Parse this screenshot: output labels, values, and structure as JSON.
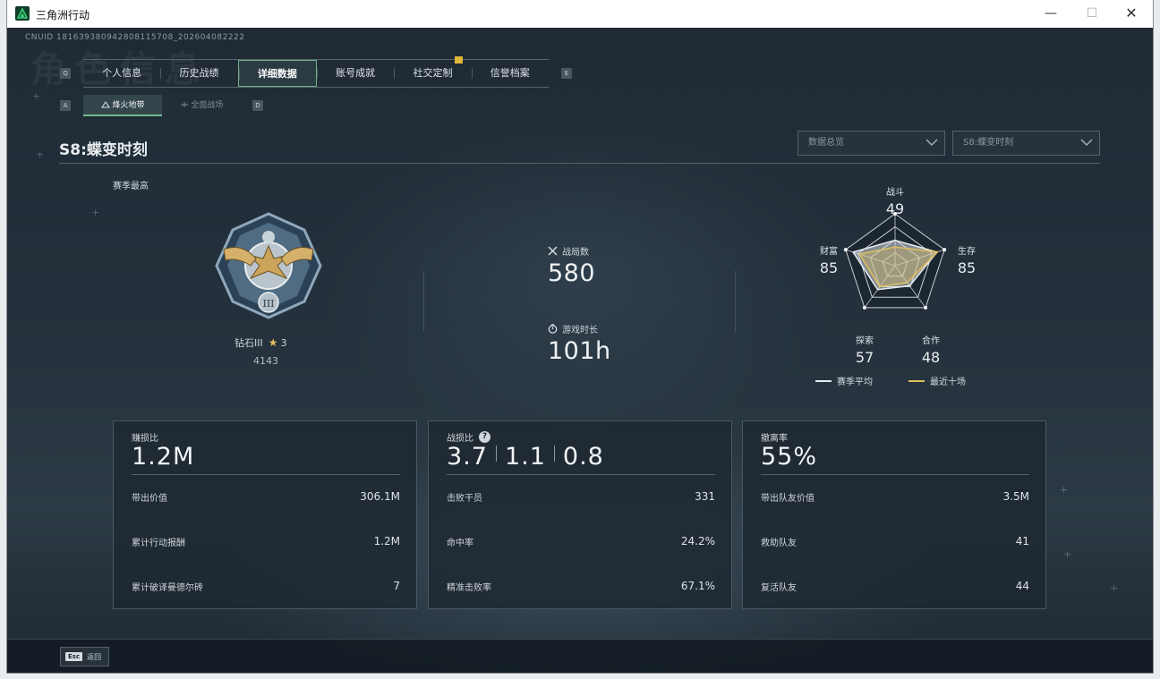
{
  "window": {
    "title": "三角洲行动",
    "min": "—",
    "max": "☐",
    "close": "✕"
  },
  "header": {
    "cnuid": "CNUID 181639380942808115708_202604082222",
    "bg_title": "角色信息"
  },
  "keyhints": {
    "tab_left": "Q",
    "tab_right": "E",
    "sub_left": "A",
    "sub_right": "D"
  },
  "tabs": [
    {
      "label": "个人信息"
    },
    {
      "label": "历史战绩"
    },
    {
      "label": "详细数据"
    },
    {
      "label": "账号成就"
    },
    {
      "label": "社交定制"
    },
    {
      "label": "信誉档案"
    }
  ],
  "subtabs": [
    {
      "label": "烽火地带"
    },
    {
      "label": "全面战场"
    }
  ],
  "season": {
    "title": "S8:蝶变时刻",
    "high_label": "赛季最高"
  },
  "dropdowns": {
    "data_overview": "数据总览",
    "season_select": "S8:蝶变时刻"
  },
  "rank": {
    "name": "钻石III",
    "stars": "3",
    "score": "4143",
    "numeral": "III"
  },
  "stats": {
    "matches_label": "战局数",
    "matches_value": "580",
    "playtime_label": "游戏时长",
    "playtime_value": "101h"
  },
  "radar": {
    "axes": [
      {
        "label": "战斗",
        "value": "49"
      },
      {
        "label": "生存",
        "value": "85"
      },
      {
        "label": "合作",
        "value": "48"
      },
      {
        "label": "探索",
        "value": "57"
      },
      {
        "label": "财富",
        "value": "85"
      }
    ],
    "season_avg": [
      49,
      85,
      48,
      57,
      85
    ],
    "recent_ten": [
      36,
      86,
      40,
      50,
      72
    ],
    "legend_avg": "赛季平均",
    "legend_recent": "最近十场",
    "color_avg": "#e8ecef",
    "color_recent": "#e0c060"
  },
  "cards": {
    "profit": {
      "label": "赚损比",
      "value": "1.2M",
      "rows": [
        {
          "label": "带出价值",
          "value": "306.1M"
        },
        {
          "label": "累计行动报酬",
          "value": "1.2M"
        },
        {
          "label": "累计破译曼德尔砖",
          "value": "7"
        }
      ]
    },
    "combat": {
      "label": "战损比",
      "v1": "3.7",
      "v2": "1.1",
      "v3": "0.8",
      "help": "?",
      "rows": [
        {
          "label": "击败干员",
          "value": "331"
        },
        {
          "label": "命中率",
          "value": "24.2%"
        },
        {
          "label": "精准击败率",
          "value": "67.1%"
        }
      ]
    },
    "extract": {
      "label": "撤离率",
      "value": "55%",
      "rows": [
        {
          "label": "带出队友价值",
          "value": "3.5M"
        },
        {
          "label": "救助队友",
          "value": "41"
        },
        {
          "label": "复活队友",
          "value": "44"
        }
      ]
    }
  },
  "bottom": {
    "esc_key": "Esc",
    "back_label": "返回"
  }
}
